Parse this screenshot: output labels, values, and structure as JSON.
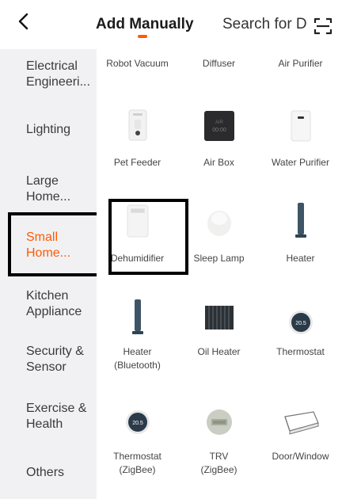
{
  "header": {
    "back_label": "<",
    "tab_add": "Add Manually",
    "tab_search": "Search for D",
    "accent_color": "#ff5a00"
  },
  "sidebar": {
    "items": [
      {
        "label": "Electrical Engineeri...",
        "active": false
      },
      {
        "label": "Lighting",
        "active": false
      },
      {
        "label": "Large Home...",
        "active": false
      },
      {
        "label": "Small Home...",
        "active": true
      },
      {
        "label": "Kitchen Appliance",
        "active": false
      },
      {
        "label": "Security & Sensor",
        "active": false
      },
      {
        "label": "Exercise & Health",
        "active": false
      },
      {
        "label": "Others",
        "active": false
      }
    ]
  },
  "devices": [
    {
      "label": "Robot Vacuum",
      "icon": "robot-vacuum-icon"
    },
    {
      "label": "Diffuser",
      "icon": "diffuser-icon"
    },
    {
      "label": "Air Purifier",
      "icon": "air-purifier-icon"
    },
    {
      "label": "Pet Feeder",
      "icon": "pet-feeder-icon"
    },
    {
      "label": "Air Box",
      "icon": "air-box-icon",
      "screen_text_1": "AIR",
      "screen_text_2": "00:00"
    },
    {
      "label": "Water Purifier",
      "icon": "water-purifier-icon"
    },
    {
      "label": "Dehumidifier",
      "icon": "dehumidifier-icon"
    },
    {
      "label": "Sleep Lamp",
      "icon": "sleep-lamp-icon"
    },
    {
      "label": "Heater",
      "icon": "tower-heater-icon"
    },
    {
      "label": "Heater (Bluetooth)",
      "icon": "tower-heater-icon"
    },
    {
      "label": "Oil Heater",
      "icon": "oil-heater-icon"
    },
    {
      "label": "Thermostat",
      "icon": "thermostat-icon",
      "display": "20.5"
    },
    {
      "label": "Thermostat (ZigBee)",
      "icon": "thermostat-icon",
      "display": "20.5"
    },
    {
      "label": "TRV (ZigBee)",
      "icon": "trv-icon"
    },
    {
      "label": "Door/Window",
      "icon": "door-window-sensor-icon"
    }
  ]
}
